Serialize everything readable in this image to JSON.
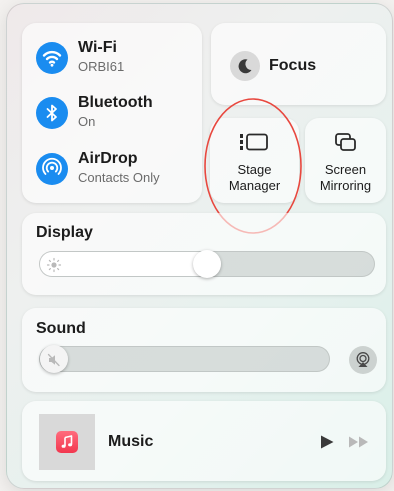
{
  "network": {
    "wifi": {
      "title": "Wi-Fi",
      "subtitle": "ORBI61",
      "icon": "wifi-icon"
    },
    "bluetooth": {
      "title": "Bluetooth",
      "subtitle": "On",
      "icon": "bluetooth-icon"
    },
    "airdrop": {
      "title": "AirDrop",
      "subtitle": "Contacts Only",
      "icon": "airdrop-icon"
    }
  },
  "focus": {
    "label": "Focus",
    "icon": "moon-icon"
  },
  "stage_manager": {
    "label_line1": "Stage",
    "label_line2": "Manager",
    "icon": "stage-manager-icon"
  },
  "screen_mirroring": {
    "label_line1": "Screen",
    "label_line2": "Mirroring",
    "icon": "screen-mirroring-icon"
  },
  "display": {
    "label": "Display",
    "brightness": 0.5,
    "icon": "sun-icon"
  },
  "sound": {
    "label": "Sound",
    "volume": 0,
    "icon": "speaker-muted-icon",
    "output_icon": "airplay-audio-icon"
  },
  "music": {
    "label": "Music",
    "app_icon": "music-note-icon",
    "play_icon": "play-icon",
    "next_icon": "fast-forward-icon"
  },
  "colors": {
    "accent_blue": "#1a8cf0",
    "annotation_red": "#e8483f",
    "music_red": "#f2374f"
  }
}
